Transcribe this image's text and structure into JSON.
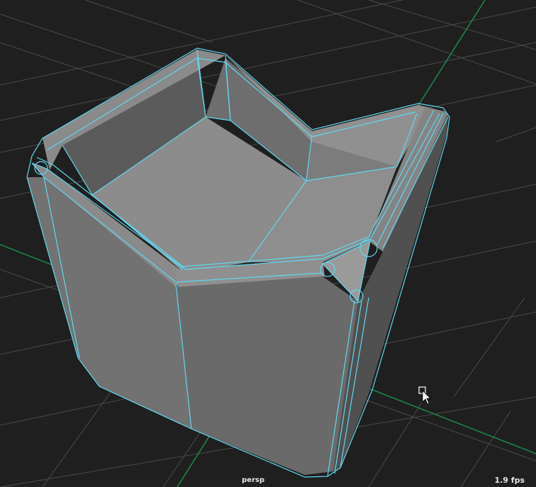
{
  "viewport": {
    "camera_name": "persp",
    "fps": "1.9 fps"
  },
  "colors": {
    "background": "#1f1f1f",
    "grid_line": "#4a4a4a",
    "axis_line": "#1c8a4a",
    "wireframe": "#5fd8f2",
    "face_light": "#8a8a8a",
    "face_mid": "#747474",
    "face_dark": "#5c5c5c"
  },
  "icons": {
    "cursor": "mouse-pointer-icon"
  }
}
